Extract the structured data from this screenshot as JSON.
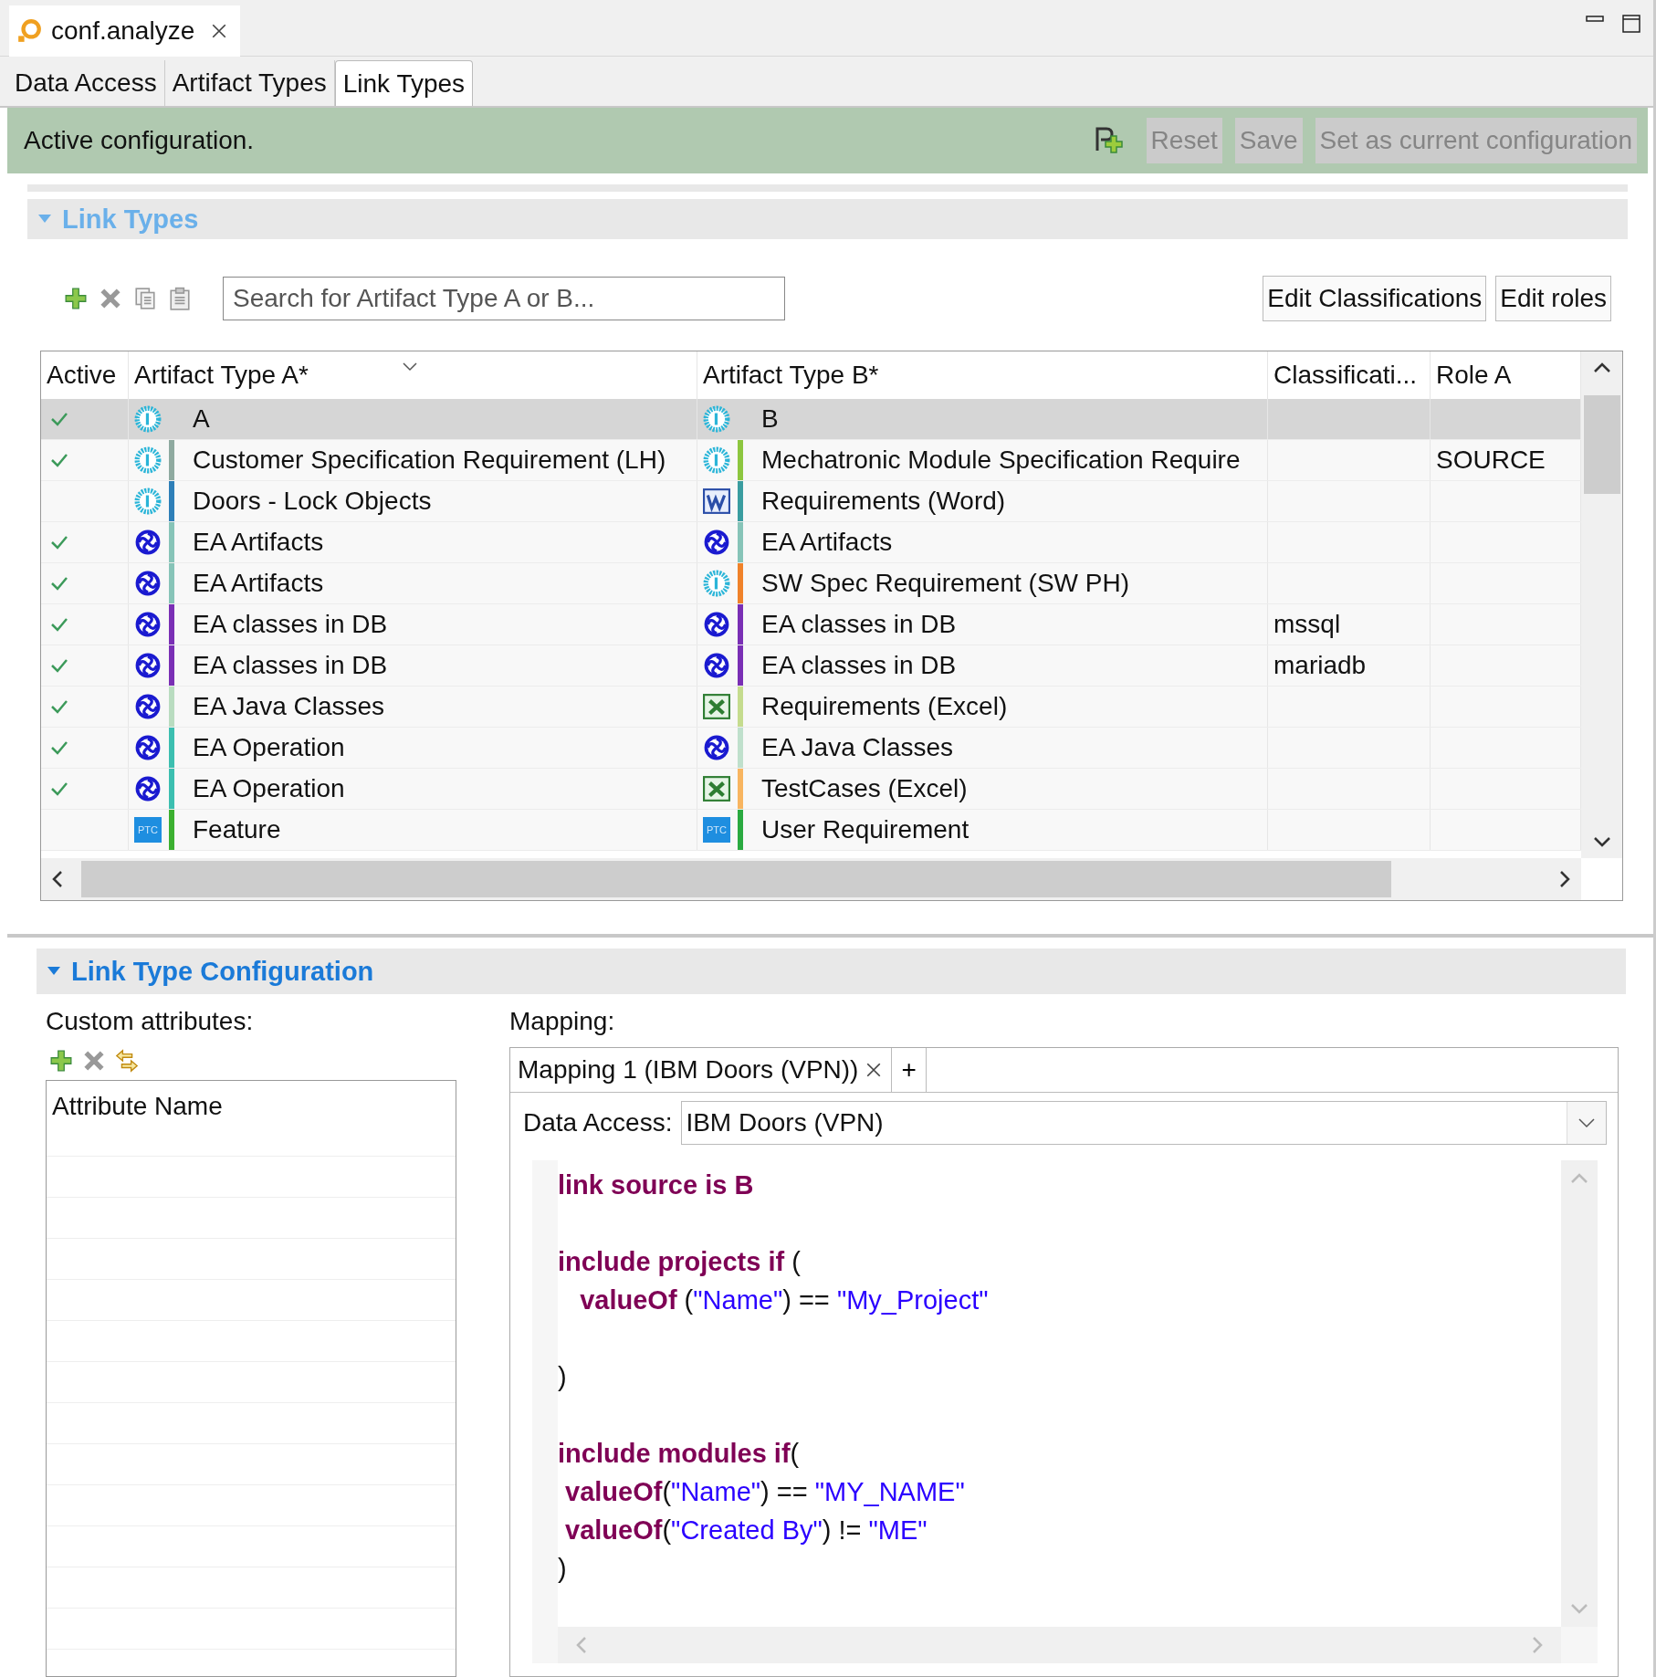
{
  "editor_tab": {
    "title": "conf.analyze"
  },
  "page_tabs": [
    {
      "label": "Data Access",
      "selected": false
    },
    {
      "label": "Artifact Types",
      "selected": false
    },
    {
      "label": "Link Types",
      "selected": true
    }
  ],
  "status_bar": {
    "message": "Active configuration.",
    "buttons": [
      {
        "label": "Reset",
        "disabled": true
      },
      {
        "label": "Save",
        "disabled": true
      },
      {
        "label": "Set as current configuration",
        "disabled": true
      }
    ]
  },
  "link_types": {
    "title": "Link Types",
    "expanded": true,
    "search": {
      "placeholder": "Search for Artifact Type A or B..."
    },
    "buttons": [
      "Edit Classifications",
      "Edit roles"
    ],
    "columns": [
      "Active",
      "Artifact Type A*",
      "Artifact Type B*",
      "Classificati...",
      "Role A"
    ],
    "rows": [
      {
        "selected": true,
        "active": true,
        "a": {
          "kind": "doors",
          "label": "A"
        },
        "b": {
          "kind": "doors",
          "label": "B"
        }
      },
      {
        "selected": false,
        "active": true,
        "a": {
          "kind": "doors",
          "color": "#8faaa0",
          "label": "Customer Specification Requirement (LH)"
        },
        "b": {
          "kind": "doors",
          "color": "#8dc63f",
          "label": "Mechatronic Module Specification Require"
        },
        "role": "SOURCE"
      },
      {
        "selected": false,
        "active": false,
        "a": {
          "kind": "doors",
          "color": "#2e7fb8",
          "label": "Doors - Lock Objects"
        },
        "b": {
          "kind": "word",
          "color": "#3a9da0",
          "label": "Requirements (Word)"
        }
      },
      {
        "selected": false,
        "active": true,
        "a": {
          "kind": "ea",
          "color": "#87c4b8",
          "label": "EA Artifacts"
        },
        "b": {
          "kind": "ea",
          "color": "#87c4b8",
          "label": "EA Artifacts"
        }
      },
      {
        "selected": false,
        "active": true,
        "a": {
          "kind": "ea",
          "color": "#87c4b8",
          "label": "EA Artifacts"
        },
        "b": {
          "kind": "doors",
          "color": "#f0822a",
          "label": "SW Spec Requirement (SW PH)"
        }
      },
      {
        "selected": false,
        "active": true,
        "a": {
          "kind": "ea",
          "color": "#7a2fb5",
          "label": "EA classes in DB"
        },
        "b": {
          "kind": "ea",
          "color": "#7a2fb5",
          "label": "EA classes in DB"
        },
        "classification": "mssql"
      },
      {
        "selected": false,
        "active": true,
        "a": {
          "kind": "ea",
          "color": "#7a2fb5",
          "label": "EA classes in DB"
        },
        "b": {
          "kind": "ea",
          "color": "#7a2fb5",
          "label": "EA classes in DB"
        },
        "classification": "mariadb"
      },
      {
        "selected": false,
        "active": true,
        "a": {
          "kind": "ea",
          "color": "#b9dcc0",
          "label": "EA Java Classes"
        },
        "b": {
          "kind": "excel",
          "color": "#c5dc8e",
          "label": "Requirements (Excel)"
        }
      },
      {
        "selected": false,
        "active": true,
        "a": {
          "kind": "ea",
          "color": "#3cbfb0",
          "label": "EA Operation"
        },
        "b": {
          "kind": "ea",
          "color": "#bfe0cc",
          "label": "EA Java Classes"
        }
      },
      {
        "selected": false,
        "active": true,
        "a": {
          "kind": "ea",
          "color": "#3cbfb0",
          "label": "EA Operation"
        },
        "b": {
          "kind": "excel",
          "color": "#f8b560",
          "label": "TestCases (Excel)"
        }
      },
      {
        "selected": false,
        "active": false,
        "a": {
          "kind": "ptc",
          "icon_text": "PTC",
          "color": "#3cb030",
          "label": "Feature"
        },
        "b": {
          "kind": "ptc",
          "icon_text": "PTC",
          "color": "#2aaa40",
          "label": "User Requirement"
        }
      }
    ]
  },
  "link_type_configuration": {
    "title": "Link Type Configuration",
    "expanded": true,
    "custom_attributes": {
      "label": "Custom attributes:",
      "column": "Attribute Name"
    },
    "mapping": {
      "label": "Mapping:",
      "tabs": [
        {
          "label": "Mapping 1 (IBM Doors (VPN))",
          "selected": true
        }
      ],
      "new_tab": "+",
      "data_access": {
        "label": "Data Access:",
        "value": "IBM Doors (VPN)"
      },
      "code_blocks": [
        [
          [
            {
              "kind": "keyword",
              "text": "link source is B"
            }
          ]
        ],
        [
          [
            {
              "kind": "keyword",
              "text": "include projects if"
            },
            {
              "kind": "plain",
              "text": " ("
            }
          ],
          [
            {
              "kind": "keyword",
              "text": "   valueOf"
            },
            {
              "kind": "plain",
              "text": " ("
            },
            {
              "kind": "string",
              "text": "\"Name\""
            },
            {
              "kind": "plain",
              "text": ") == "
            },
            {
              "kind": "string",
              "text": "\"My_Project\""
            }
          ]
        ],
        [
          [
            {
              "kind": "plain",
              "text": ")"
            }
          ]
        ],
        [
          [
            {
              "kind": "keyword",
              "text": "include modules if"
            },
            {
              "kind": "plain",
              "text": "("
            }
          ],
          [
            {
              "kind": "keyword",
              "text": " valueOf"
            },
            {
              "kind": "plain",
              "text": "("
            },
            {
              "kind": "string",
              "text": "\"Name\""
            },
            {
              "kind": "plain",
              "text": ") == "
            },
            {
              "kind": "string",
              "text": "\"MY_NAME\""
            }
          ],
          [
            {
              "kind": "keyword",
              "text": " valueOf"
            },
            {
              "kind": "plain",
              "text": "("
            },
            {
              "kind": "string",
              "text": "\"Created By\""
            },
            {
              "kind": "plain",
              "text": ") != "
            },
            {
              "kind": "string",
              "text": "\"ME\""
            }
          ],
          [
            {
              "kind": "plain",
              "text": ")"
            }
          ]
        ]
      ]
    }
  }
}
